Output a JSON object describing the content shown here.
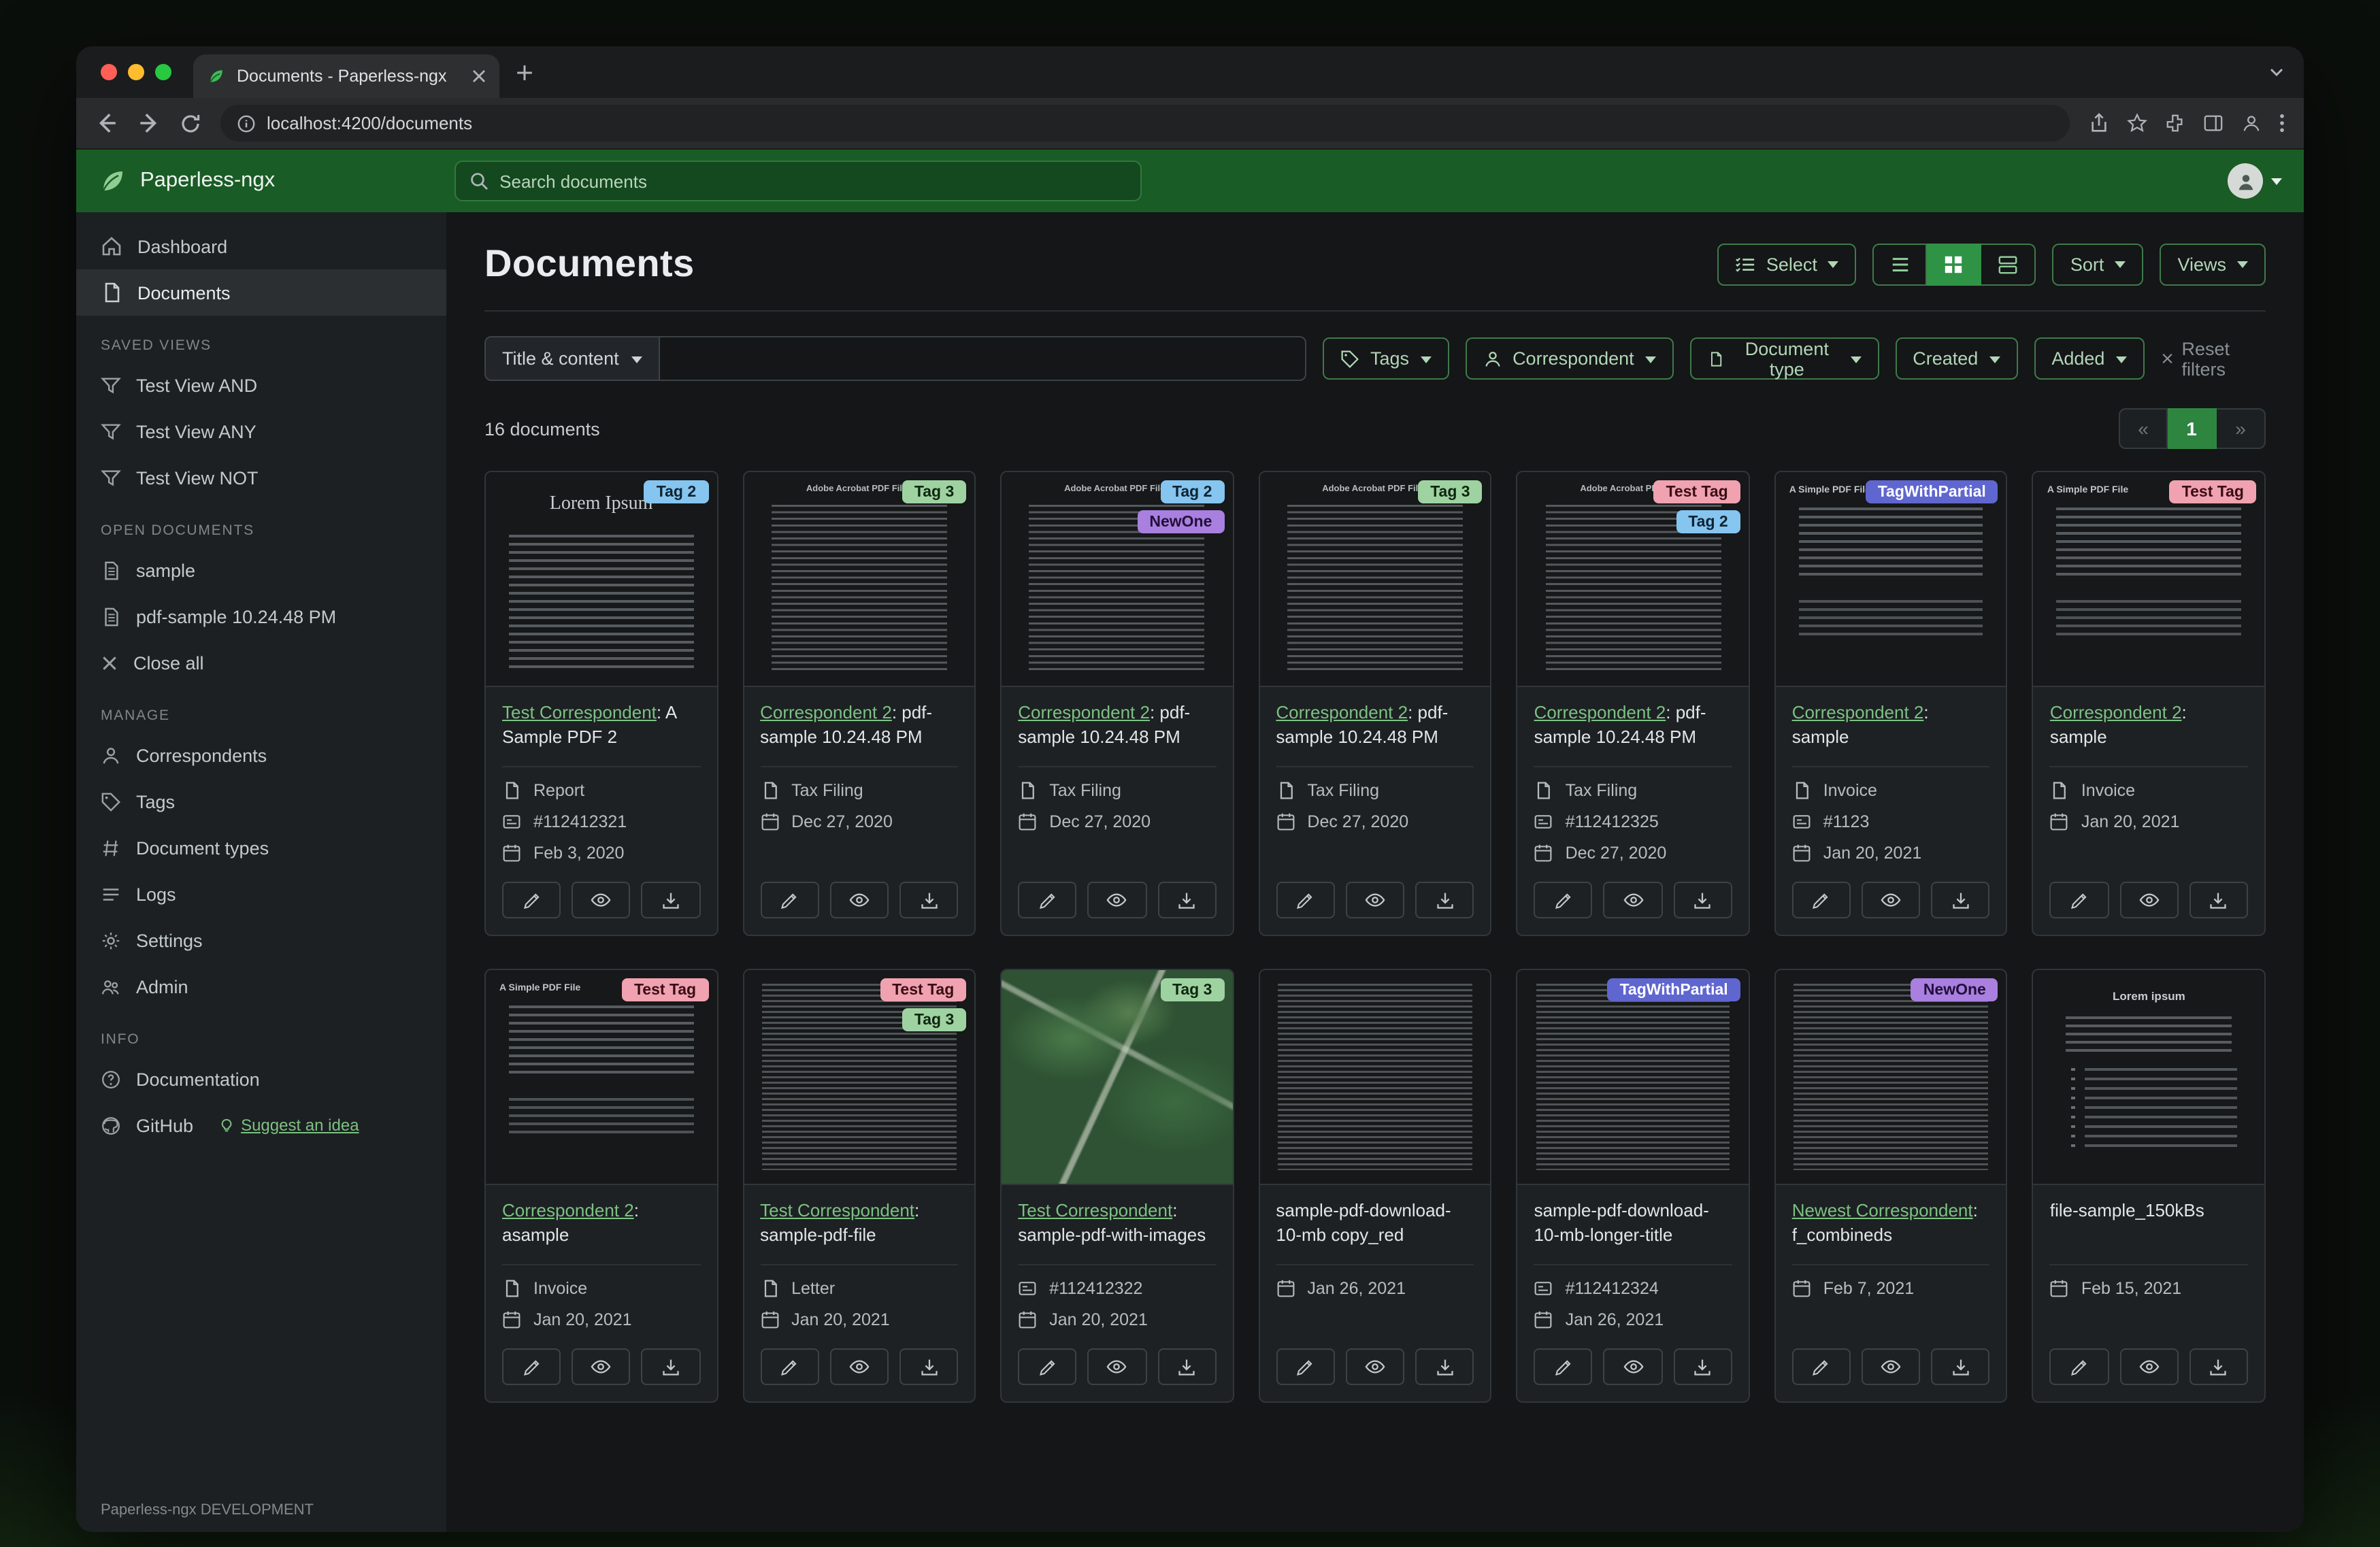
{
  "browser": {
    "tab_title": "Documents - Paperless-ngx",
    "url": "localhost:4200/documents"
  },
  "app_header": {
    "brand": "Paperless-ngx",
    "search_placeholder": "Search documents"
  },
  "sidebar": {
    "dashboard": "Dashboard",
    "documents": "Documents",
    "saved_views_header": "SAVED VIEWS",
    "saved_views": [
      "Test View AND",
      "Test View ANY",
      "Test View NOT"
    ],
    "open_documents_header": "OPEN DOCUMENTS",
    "open_documents": [
      "sample",
      "pdf-sample 10.24.48 PM"
    ],
    "close_all": "Close all",
    "manage_header": "MANAGE",
    "manage": [
      "Correspondents",
      "Tags",
      "Document types",
      "Logs",
      "Settings",
      "Admin"
    ],
    "info_header": "INFO",
    "documentation": "Documentation",
    "github": "GitHub",
    "suggest": "Suggest an idea",
    "footer": "Paperless-ngx DEVELOPMENT"
  },
  "main": {
    "title": "Documents",
    "select_label": "Select",
    "sort_label": "Sort",
    "views_label": "Views",
    "filter": {
      "title_content": "Title & content",
      "tags": "Tags",
      "correspondent": "Correspondent",
      "document_type": "Document type",
      "created": "Created",
      "added": "Added",
      "reset": "Reset filters"
    },
    "count": "16 documents",
    "pagination": {
      "prev": "«",
      "page": "1",
      "next": "»"
    }
  },
  "colors": {
    "accent_green": "#2f9345",
    "link_green": "#7cc183",
    "header_green": "#1a5c26"
  },
  "documents": [
    {
      "thumb": {
        "kind": "lorem",
        "heading": "Lorem Ipsum"
      },
      "tags": [
        {
          "label": "Tag 2",
          "bg": "#85c5f0",
          "fg": "#102331"
        }
      ],
      "title_link": "Test Correspondent",
      "title_rest": ": A Sample PDF 2",
      "doc_type": "Report",
      "asn": "#112412321",
      "date": "Feb 3, 2020"
    },
    {
      "thumb": {
        "kind": "adobe",
        "heading": "Adobe Acrobat PDF Files"
      },
      "tags": [
        {
          "label": "Tag 3",
          "bg": "#9ed3a1",
          "fg": "#10260f"
        }
      ],
      "title_link": "Correspondent 2",
      "title_rest": ": pdf-sample 10.24.48 PM",
      "doc_type": "Tax Filing",
      "asn": "",
      "date": "Dec 27, 2020"
    },
    {
      "thumb": {
        "kind": "adobe",
        "heading": "Adobe Acrobat PDF Files"
      },
      "tags": [
        {
          "label": "Tag 2",
          "bg": "#85c5f0",
          "fg": "#102331"
        },
        {
          "label": "NewOne",
          "bg": "#a97fe0",
          "fg": "#221038"
        }
      ],
      "title_link": "Correspondent 2",
      "title_rest": ": pdf-sample 10.24.48 PM",
      "doc_type": "Tax Filing",
      "asn": "",
      "date": "Dec 27, 2020"
    },
    {
      "thumb": {
        "kind": "adobe",
        "heading": "Adobe Acrobat PDF Files"
      },
      "tags": [
        {
          "label": "Tag 3",
          "bg": "#9ed3a1",
          "fg": "#10260f"
        }
      ],
      "title_link": "Correspondent 2",
      "title_rest": ": pdf-sample 10.24.48 PM",
      "doc_type": "Tax Filing",
      "asn": "",
      "date": "Dec 27, 2020"
    },
    {
      "thumb": {
        "kind": "adobe",
        "heading": "Adobe Acrobat PDF Files"
      },
      "tags": [
        {
          "label": "Test Tag",
          "bg": "#f0a2b0",
          "fg": "#3a0d16"
        },
        {
          "label": "Tag 2",
          "bg": "#85c5f0",
          "fg": "#102331"
        }
      ],
      "title_link": "Correspondent 2",
      "title_rest": ": pdf-sample 10.24.48 PM",
      "doc_type": "Tax Filing",
      "asn": "#112412325",
      "date": "Dec 27, 2020"
    },
    {
      "thumb": {
        "kind": "simple",
        "heading": "A Simple PDF File"
      },
      "tags": [
        {
          "label": "TagWithPartial",
          "bg": "#5f66cf",
          "fg": "#ffffff"
        }
      ],
      "title_link": "Correspondent 2",
      "title_rest": ": sample",
      "doc_type": "Invoice",
      "asn": "#1123",
      "date": "Jan 20, 2021"
    },
    {
      "thumb": {
        "kind": "simple",
        "heading": "A Simple PDF File"
      },
      "tags": [
        {
          "label": "Test Tag",
          "bg": "#f0a2b0",
          "fg": "#3a0d16"
        }
      ],
      "title_link": "Correspondent 2",
      "title_rest": ": sample",
      "doc_type": "Invoice",
      "asn": "",
      "date": "Jan 20, 2021"
    },
    {
      "thumb": {
        "kind": "simple",
        "heading": "A Simple PDF File"
      },
      "tags": [
        {
          "label": "Test Tag",
          "bg": "#f0a2b0",
          "fg": "#3a0d16"
        }
      ],
      "title_link": "Correspondent 2",
      "title_rest": ": asample",
      "doc_type": "Invoice",
      "asn": "",
      "date": "Jan 20, 2021"
    },
    {
      "thumb": {
        "kind": "dense",
        "heading": ""
      },
      "tags": [
        {
          "label": "Test Tag",
          "bg": "#f0a2b0",
          "fg": "#3a0d16"
        },
        {
          "label": "Tag 3",
          "bg": "#9ed3a1",
          "fg": "#10260f"
        }
      ],
      "title_link": "Test Correspondent",
      "title_rest": ": sample-pdf-file",
      "doc_type": "Letter",
      "asn": "",
      "date": "Jan 20, 2021"
    },
    {
      "thumb": {
        "kind": "map",
        "heading": ""
      },
      "tags": [
        {
          "label": "Tag 3",
          "bg": "#9ed3a1",
          "fg": "#10260f"
        }
      ],
      "title_link": "Test Correspondent",
      "title_rest": ": sample-pdf-with-images",
      "doc_type": "",
      "asn": "#112412322",
      "date": "Jan 20, 2021"
    },
    {
      "thumb": {
        "kind": "dense",
        "heading": ""
      },
      "tags": [],
      "title_link": "",
      "title_rest": "sample-pdf-download-10-mb copy_red",
      "doc_type": "",
      "asn": "",
      "date": "Jan 26, 2021"
    },
    {
      "thumb": {
        "kind": "dense",
        "heading": ""
      },
      "tags": [
        {
          "label": "TagWithPartial",
          "bg": "#5f66cf",
          "fg": "#ffffff"
        }
      ],
      "title_link": "",
      "title_rest": "sample-pdf-download-10-mb-longer-title",
      "doc_type": "",
      "asn": "#112412324",
      "date": "Jan 26, 2021"
    },
    {
      "thumb": {
        "kind": "dense",
        "heading": ""
      },
      "tags": [
        {
          "label": "NewOne",
          "bg": "#a97fe0",
          "fg": "#221038"
        }
      ],
      "title_link": "Newest Correspondent",
      "title_rest": ": f_combineds",
      "doc_type": "",
      "asn": "",
      "date": "Feb 7, 2021"
    },
    {
      "thumb": {
        "kind": "bullets",
        "heading": "Lorem ipsum"
      },
      "tags": [],
      "title_link": "",
      "title_rest": "file-sample_150kBs",
      "doc_type": "",
      "asn": "",
      "date": "Feb 15, 2021"
    }
  ]
}
